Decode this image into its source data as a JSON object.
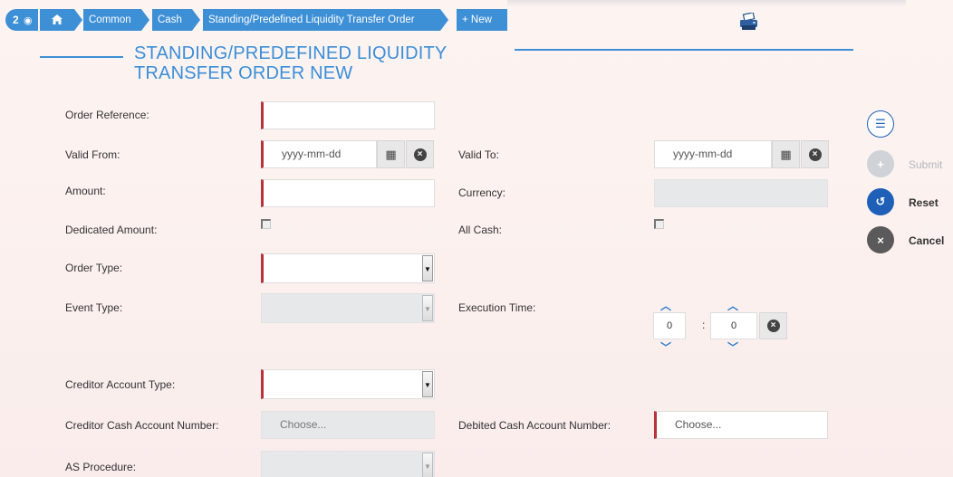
{
  "breadcrumb": {
    "badge_count": "2",
    "items": [
      "Common",
      "Cash",
      "Standing/Predefined Liquidity Transfer Order"
    ],
    "new_label": "+ New"
  },
  "title": {
    "line1": "STANDING/PREDEFINED LIQUIDITY",
    "line2": "TRANSFER ORDER NEW"
  },
  "form": {
    "order_reference": {
      "label": "Order Reference:",
      "value": ""
    },
    "valid_from": {
      "label": "Valid From:",
      "placeholder": "yyyy-mm-dd"
    },
    "valid_to": {
      "label": "Valid To:",
      "placeholder": "yyyy-mm-dd"
    },
    "amount": {
      "label": "Amount:",
      "value": ""
    },
    "currency": {
      "label": "Currency:",
      "value": ""
    },
    "dedicated_amount": {
      "label": "Dedicated Amount:",
      "checked": false
    },
    "all_cash": {
      "label": "All Cash:",
      "checked": false
    },
    "order_type": {
      "label": "Order Type:",
      "value": ""
    },
    "event_type": {
      "label": "Event Type:",
      "value": ""
    },
    "execution_time": {
      "label": "Execution Time:",
      "hours": "0",
      "separator": ":",
      "minutes": "0"
    },
    "creditor_account_type": {
      "label": "Creditor Account Type:",
      "value": ""
    },
    "creditor_cash_account_number": {
      "label": "Creditor Cash Account Number:",
      "placeholder": "Choose..."
    },
    "debited_cash_account_number": {
      "label": "Debited Cash Account Number:",
      "placeholder": "Choose..."
    },
    "as_procedure": {
      "label": "AS Procedure:",
      "value": ""
    }
  },
  "actions": {
    "submit": "Submit",
    "reset": "Reset",
    "cancel": "Cancel"
  },
  "colors": {
    "accent": "#3d8fd6",
    "required_marker": "#b8333a",
    "reset_button": "#1f5fb8",
    "cancel_button": "#5a5a5a",
    "submit_disabled": "#cfd2d6"
  },
  "icons": {
    "home": "home-icon",
    "eye": "eye-icon",
    "printer": "printer-icon",
    "calendar": "calendar-icon",
    "clear": "clear-icon",
    "list": "list-icon",
    "plus": "plus-icon",
    "undo": "undo-icon",
    "close": "close-icon"
  }
}
